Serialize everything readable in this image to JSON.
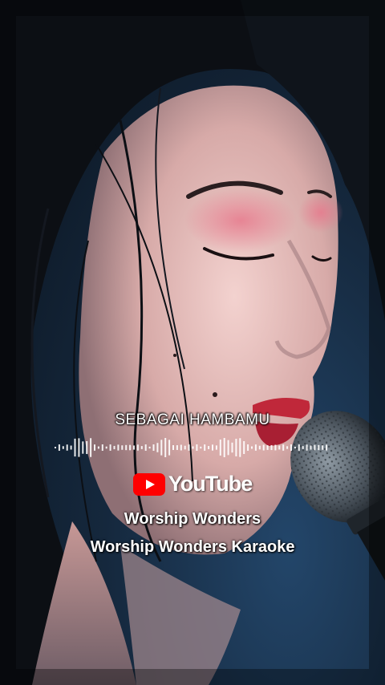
{
  "lyric": {
    "text": "SEBAGAI HAMBAMU"
  },
  "brand": {
    "name": "YouTube",
    "color": "#ff0000",
    "icon": "youtube-play-icon"
  },
  "channel": {
    "name": "Worship Wonders",
    "subtitle": "Worship Wonders Karaoke"
  },
  "visualizer": {
    "icon": "audio-waveform-icon"
  },
  "colors": {
    "background": "#15283d",
    "lips": "#c0283a",
    "text": "#ffffff"
  }
}
